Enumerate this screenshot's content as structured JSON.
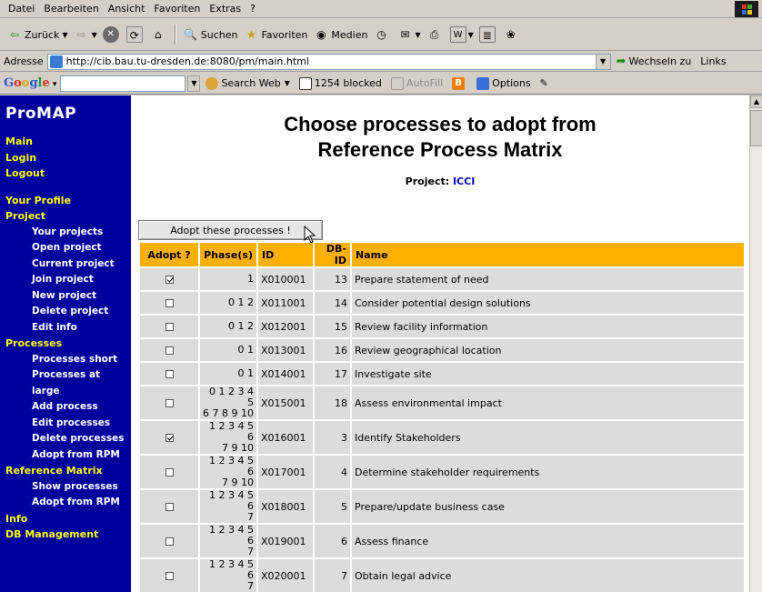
{
  "browser": {
    "menu": [
      "Datei",
      "Bearbeiten",
      "Ansicht",
      "Favoriten",
      "Extras",
      "?"
    ],
    "toolbar": {
      "back_label": "Zurück",
      "search_label": "Suchen",
      "favorites_label": "Favoriten",
      "media_label": "Medien"
    },
    "address": {
      "label": "Adresse",
      "url": "http://cib.bau.tu-dresden.de:8080/pm/main.html",
      "go_label": "Wechseln zu",
      "links_label": "Links"
    },
    "google": {
      "logo": "Google",
      "search_web": "Search Web",
      "blocked": "1254 blocked",
      "autofill": "AutoFill",
      "options": "Options"
    }
  },
  "sidebar": {
    "brand": "ProMAP",
    "items": [
      {
        "label": "Main",
        "level": "top",
        "gap": false
      },
      {
        "label": "Login",
        "level": "top",
        "gap": false
      },
      {
        "label": "Logout",
        "level": "top",
        "gap": false
      },
      {
        "label": "Your Profile",
        "level": "top",
        "gap": true
      },
      {
        "label": "Project",
        "level": "top",
        "gap": false
      },
      {
        "label": "Your projects",
        "level": "sub",
        "gap": false
      },
      {
        "label": "Open project",
        "level": "sub",
        "gap": false
      },
      {
        "label": "Current project",
        "level": "sub",
        "gap": false
      },
      {
        "label": "Join project",
        "level": "sub",
        "gap": false
      },
      {
        "label": "New project",
        "level": "sub",
        "gap": false
      },
      {
        "label": "Delete project",
        "level": "sub",
        "gap": false
      },
      {
        "label": "Edit info",
        "level": "sub",
        "gap": false
      },
      {
        "label": "Processes",
        "level": "top",
        "gap": false
      },
      {
        "label": "Processes short",
        "level": "sub",
        "gap": false
      },
      {
        "label": "Processes at large",
        "level": "sub",
        "gap": false
      },
      {
        "label": "Add process",
        "level": "sub",
        "gap": false
      },
      {
        "label": "Edit processes",
        "level": "sub",
        "gap": false
      },
      {
        "label": "Delete processes",
        "level": "sub",
        "gap": false
      },
      {
        "label": "Adopt from RPM",
        "level": "sub",
        "gap": false
      },
      {
        "label": "Reference Matrix",
        "level": "top",
        "gap": false
      },
      {
        "label": "Show processes",
        "level": "sub",
        "gap": false
      },
      {
        "label": "Adopt from RPM",
        "level": "sub",
        "gap": false
      },
      {
        "label": "Info",
        "level": "top",
        "gap": false
      },
      {
        "label": "DB Management",
        "level": "top",
        "gap": false
      }
    ]
  },
  "main": {
    "title_line1": "Choose processes to adopt from",
    "title_line2": "Reference Process Matrix",
    "project_label": "Project:",
    "project_name": "ICCI",
    "adopt_button": "Adopt these processes !",
    "columns": [
      "Adopt ?",
      "Phase(s)",
      "ID",
      "DB-ID",
      "Name"
    ],
    "rows": [
      {
        "checked": true,
        "phases": [
          "1"
        ],
        "id": "X010001",
        "dbid": "13",
        "name": "Prepare statement of need"
      },
      {
        "checked": false,
        "phases": [
          "0 1 2"
        ],
        "id": "X011001",
        "dbid": "14",
        "name": "Consider potential design solutions"
      },
      {
        "checked": false,
        "phases": [
          "0 1 2"
        ],
        "id": "X012001",
        "dbid": "15",
        "name": "Review facility information"
      },
      {
        "checked": false,
        "phases": [
          "0 1"
        ],
        "id": "X013001",
        "dbid": "16",
        "name": "Review geographical location"
      },
      {
        "checked": false,
        "phases": [
          "0 1"
        ],
        "id": "X014001",
        "dbid": "17",
        "name": "Investigate site"
      },
      {
        "checked": false,
        "phases": [
          "0 1 2 3 4 5",
          "6 7 8 9 10"
        ],
        "id": "X015001",
        "dbid": "18",
        "name": "Assess environmental impact"
      },
      {
        "checked": true,
        "phases": [
          "1 2 3 4 5 6",
          "7 9 10"
        ],
        "id": "X016001",
        "dbid": "3",
        "name": "Identify Stakeholders"
      },
      {
        "checked": false,
        "phases": [
          "1 2 3 4 5 6",
          "7 9 10"
        ],
        "id": "X017001",
        "dbid": "4",
        "name": "Determine stakeholder requirements"
      },
      {
        "checked": false,
        "phases": [
          "1 2 3 4 5 6",
          "7"
        ],
        "id": "X018001",
        "dbid": "5",
        "name": "Prepare/update business case"
      },
      {
        "checked": false,
        "phases": [
          "1 2 3 4 5 6",
          "7"
        ],
        "id": "X019001",
        "dbid": "6",
        "name": "Assess finance"
      },
      {
        "checked": false,
        "phases": [
          "1 2 3 4 5 6",
          "7"
        ],
        "id": "X020001",
        "dbid": "7",
        "name": "Obtain legal advice"
      }
    ]
  },
  "colors": {
    "sidebar_bg": "#00009c",
    "nav_top": "#ffff00",
    "nav_sub": "#ffffff",
    "header_bg": "#ffb000",
    "cell_bg": "#dcdcdc",
    "link": "#0000cc"
  }
}
